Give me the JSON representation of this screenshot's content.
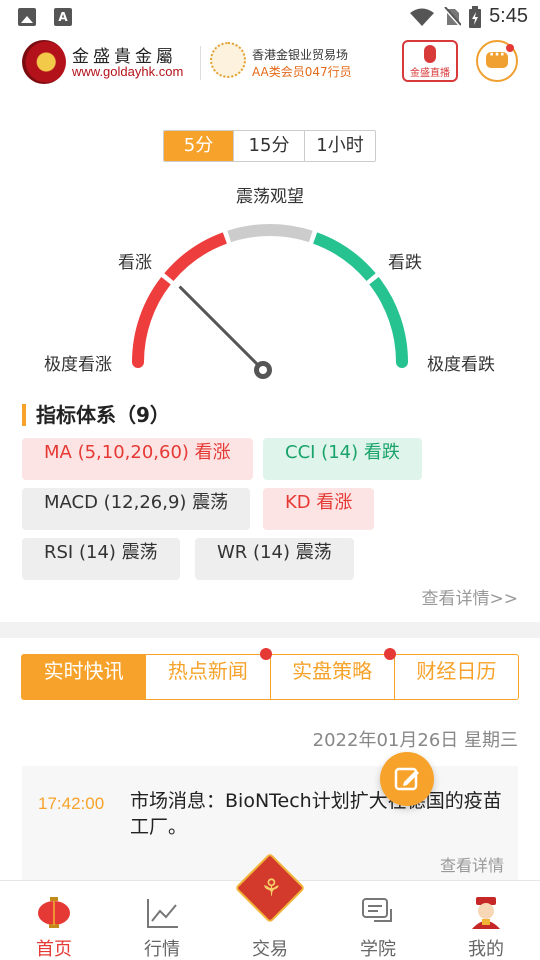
{
  "status_bar": {
    "time": "5:45"
  },
  "header": {
    "brand_name": "金盛貴金屬",
    "brand_url": "www.goldayhk.com",
    "member_line1": "香港金银业贸易场",
    "member_line2": "AA类会员047行员",
    "live_label": "金盛直播"
  },
  "timeframes": [
    {
      "label": "5分",
      "active": true
    },
    {
      "label": "15分",
      "active": false
    },
    {
      "label": "1小时",
      "active": false
    }
  ],
  "gauge": {
    "labels": {
      "neutral": "震荡观望",
      "bullish": "看涨",
      "bearish": "看跌",
      "strong_bullish": "极度看涨",
      "strong_bearish": "极度看跌"
    },
    "reading": "bullish",
    "colors": {
      "bull": "#ee3d3d",
      "neutral": "#cccccc",
      "bear": "#26c28f",
      "needle": "#555555"
    }
  },
  "indicators": {
    "title": "指标体系（9）",
    "items": [
      {
        "text": "MA (5,10,20,60) 看涨",
        "signal": "up"
      },
      {
        "text": "CCI (14) 看跌",
        "signal": "down"
      },
      {
        "text": "MACD (12,26,9) 震荡",
        "signal": "neutral"
      },
      {
        "text": "KD 看涨",
        "signal": "up"
      },
      {
        "text": "RSI (14) 震荡",
        "signal": "neutral"
      },
      {
        "text": "WR (14) 震荡",
        "signal": "neutral"
      }
    ],
    "details_link": "查看详情>>"
  },
  "news_tabs": [
    {
      "label": "实时快讯",
      "active": true,
      "dot": false
    },
    {
      "label": "热点新闻",
      "active": false,
      "dot": true
    },
    {
      "label": "实盘策略",
      "active": false,
      "dot": true
    },
    {
      "label": "财经日历",
      "active": false,
      "dot": false
    }
  ],
  "news": {
    "date": "2022年01月26日 星期三",
    "items": [
      {
        "time": "17:42:00",
        "text": "市场消息：BioNTech计划扩大在德国的疫苗工厂。",
        "more": "查看详情"
      }
    ]
  },
  "bottom_nav": [
    {
      "label": "首页",
      "icon": "lantern-icon",
      "active": true
    },
    {
      "label": "行情",
      "icon": "chart-icon",
      "active": false
    },
    {
      "label": "交易",
      "icon": "trade-icon",
      "active": false
    },
    {
      "label": "学院",
      "icon": "chat-bubbles-icon",
      "active": false
    },
    {
      "label": "我的",
      "icon": "god-of-wealth-icon",
      "active": false
    }
  ],
  "theme": {
    "accent": "#f7a32b",
    "up": "#e53935",
    "down": "#19a36a"
  }
}
